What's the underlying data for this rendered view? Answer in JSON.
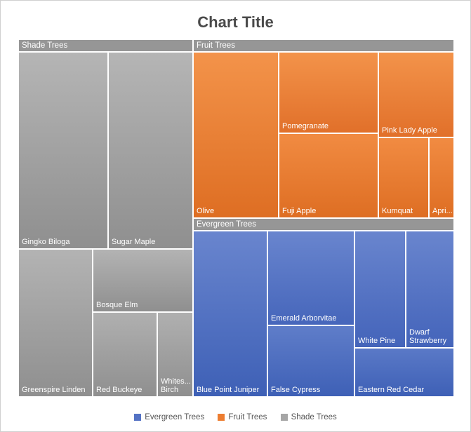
{
  "title": "Chart Title",
  "legend": [
    {
      "label": "Evergreen Trees",
      "color": "#5472C4"
    },
    {
      "label": "Fruit Trees",
      "color": "#ED7D31"
    },
    {
      "label": "Shade Trees",
      "color": "#A6A6A6"
    }
  ],
  "headers": {
    "shade": "Shade Trees",
    "fruit": "Fruit Trees",
    "evergreen": "Evergreen Trees"
  },
  "labels": {
    "gingko": "Gingko Biloga",
    "sugar": "Sugar Maple",
    "greenspire": "Greenspire Linden",
    "bosque": "Bosque Elm",
    "redbuckeye": "Red Buckeye",
    "whitebirch": "Whites... Birch",
    "olive": "Olive",
    "pomegranate": "Pomegranate",
    "fuji": "Fuji Apple",
    "pinklady": "Pink Lady Apple",
    "kumquat": "Kumquat",
    "apricot": "Apri...",
    "bluejuniper": "Blue Point Juniper",
    "emerald": "Emerald Arborvitae",
    "falsecypress": "False Cypress",
    "whitepine": "White Pine",
    "dwarfstraw": "Dwarf Strawberry",
    "eastredcedar": "Eastern Red Cedar"
  },
  "chart_data": {
    "type": "treemap",
    "title": "Chart Title",
    "series": [
      {
        "name": "Shade Trees",
        "color": "#A6A6A6",
        "items": [
          {
            "name": "Gingko Biloga",
            "value": 34
          },
          {
            "name": "Sugar Maple",
            "value": 32
          },
          {
            "name": "Greenspire Linden",
            "value": 22
          },
          {
            "name": "Bosque Elm",
            "value": 12
          },
          {
            "name": "Red Buckeye",
            "value": 15
          },
          {
            "name": "Whitespire Birch",
            "value": 7
          }
        ]
      },
      {
        "name": "Fruit Trees",
        "color": "#ED7D31",
        "items": [
          {
            "name": "Olive",
            "value": 28
          },
          {
            "name": "Pomegranate",
            "value": 16
          },
          {
            "name": "Fuji Apple",
            "value": 16
          },
          {
            "name": "Pink Lady Apple",
            "value": 13
          },
          {
            "name": "Kumquat",
            "value": 9
          },
          {
            "name": "Apricot",
            "value": 4
          }
        ]
      },
      {
        "name": "Evergreen Trees",
        "color": "#5472C4",
        "items": [
          {
            "name": "Blue Point Juniper",
            "value": 21
          },
          {
            "name": "Emerald Arborvitae",
            "value": 12
          },
          {
            "name": "False Cypress",
            "value": 11
          },
          {
            "name": "White Pine",
            "value": 13
          },
          {
            "name": "Dwarf Strawberry",
            "value": 9
          },
          {
            "name": "Eastern Red Cedar",
            "value": 9
          }
        ]
      }
    ]
  }
}
